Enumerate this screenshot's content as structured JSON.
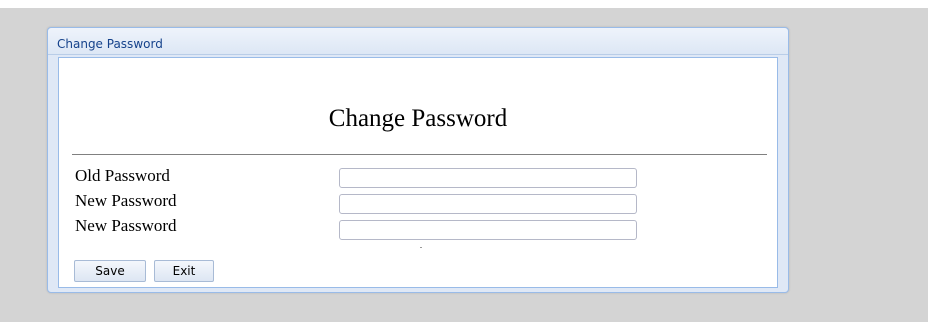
{
  "window": {
    "title": "Change Password"
  },
  "form": {
    "heading": "Change Password",
    "fields": [
      {
        "label": "Old Password",
        "value": ""
      },
      {
        "label": "New Password",
        "value": ""
      },
      {
        "label": "New Password",
        "value": ""
      }
    ],
    "buttons": {
      "save_label": "Save",
      "exit_label": "Exit"
    }
  },
  "colors": {
    "background": "#d4d4d4",
    "window_frame": "#dfe8f6",
    "window_border": "#99bbe8",
    "title_text": "#15428b"
  }
}
